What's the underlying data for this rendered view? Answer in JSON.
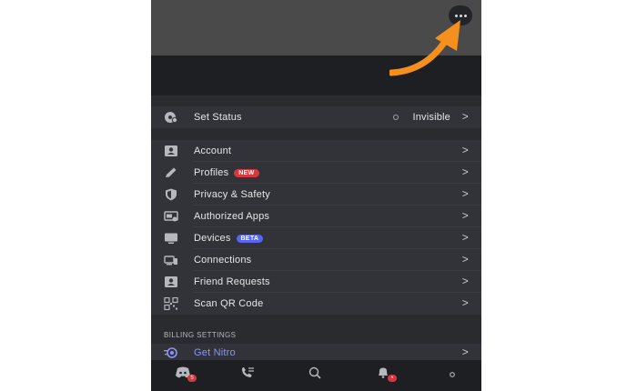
{
  "menu": {
    "set_status": {
      "label": "Set Status",
      "value": "Invisible"
    },
    "items": [
      {
        "label": "Account"
      },
      {
        "label": "Profiles",
        "badge": "NEW"
      },
      {
        "label": "Privacy & Safety"
      },
      {
        "label": "Authorized Apps"
      },
      {
        "label": "Devices",
        "badge": "BETA"
      },
      {
        "label": "Connections"
      },
      {
        "label": "Friend Requests"
      },
      {
        "label": "Scan QR Code"
      }
    ],
    "billing_header": "BILLING SETTINGS",
    "get_nitro": "Get Nitro",
    "chevron": ">"
  },
  "bottom_nav": {
    "home_badge": "5",
    "notifications_badge": "•"
  },
  "colors": {
    "accent": "#5865f2",
    "new_badge": "#da373c",
    "arrow": "#f5901e"
  },
  "icons": {
    "more": "more-dots-icon",
    "status": "status-icon",
    "account": "account-icon",
    "profiles": "pencil-icon",
    "privacy": "shield-icon",
    "apps": "authorized-apps-icon",
    "devices": "monitor-icon",
    "connections": "connections-icon",
    "friends": "friend-requests-icon",
    "qr": "qr-code-icon",
    "nitro": "nitro-icon"
  }
}
